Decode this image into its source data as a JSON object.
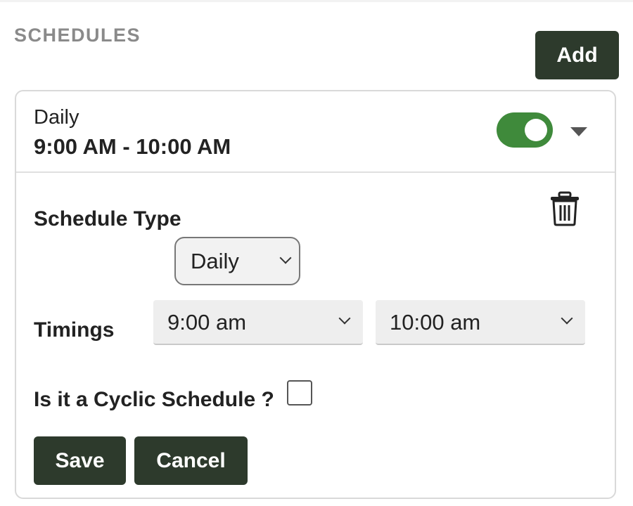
{
  "section": {
    "title": "SCHEDULES",
    "add_label": "Add"
  },
  "schedule": {
    "summary_type": "Daily",
    "summary_time": "9:00 AM - 10:00 AM",
    "enabled": true,
    "toggle_color": "#3f8a3b"
  },
  "form": {
    "schedule_type_label": "Schedule Type",
    "schedule_type_value": "Daily",
    "timings_label": "Timings",
    "start_time": "9:00 am",
    "end_time": "10:00 am",
    "cyclic_label": "Is it a Cyclic Schedule ?",
    "cyclic_checked": false,
    "save_label": "Save",
    "cancel_label": "Cancel"
  },
  "colors": {
    "button_bg": "#2d3a2c",
    "accent_green": "#3f8a3b"
  },
  "icons": {
    "delete": "trash-icon",
    "expand": "caret-down-icon",
    "select": "chevron-down-icon"
  }
}
